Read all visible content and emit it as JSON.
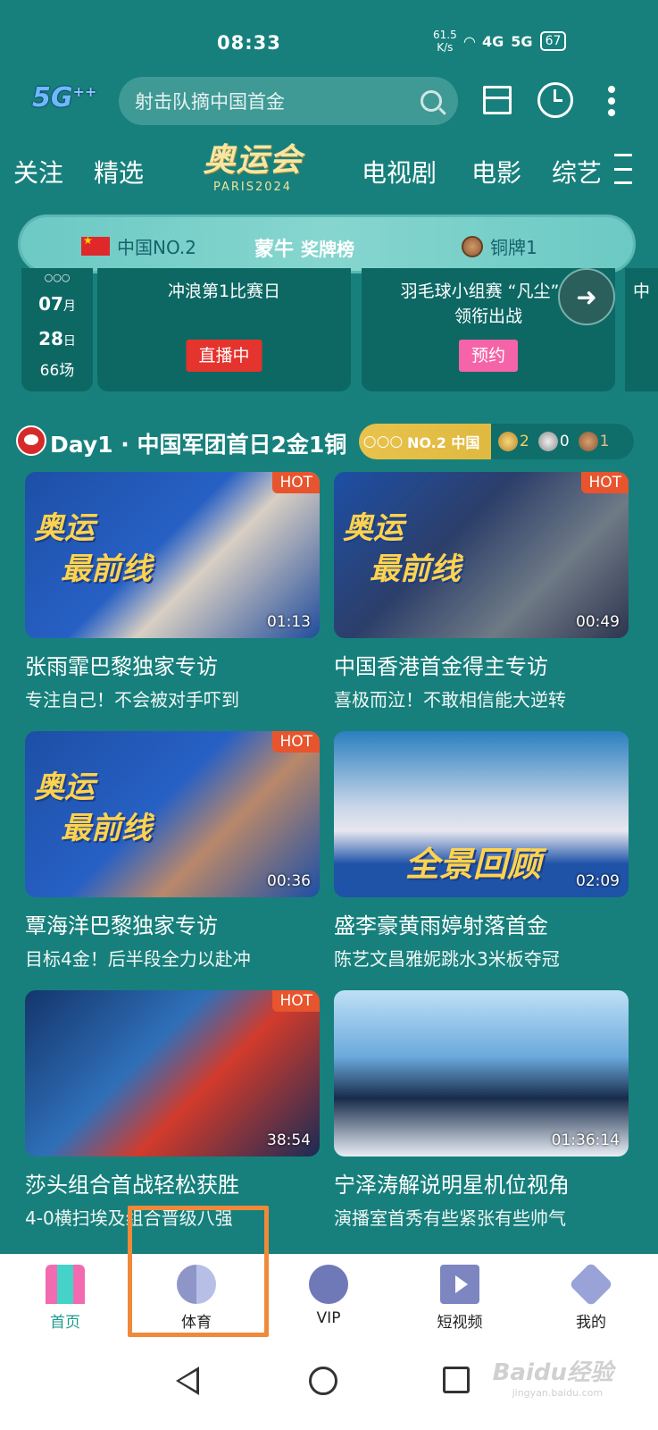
{
  "status": {
    "time": "08:33",
    "net_speed_value": "61.5",
    "net_speed_unit": "K/s",
    "sig1": "4G",
    "sig2": "5G",
    "battery": "67"
  },
  "header": {
    "logo": "5G",
    "logo_sup": "++",
    "search_placeholder": "射击队摘中国首金"
  },
  "tabs": {
    "follow": "关注",
    "featured": "精选",
    "olympic_title": "奥运会",
    "olympic_sub": "PARIS2024",
    "tv": "电视剧",
    "movie": "电影",
    "variety": "综艺"
  },
  "medal_banner": {
    "rank": "中国NO.2",
    "brand": "蒙牛",
    "board": "奖牌榜",
    "bronze": "铜牌1"
  },
  "schedule": {
    "month": "07",
    "month_unit": "月",
    "day": "28",
    "day_unit": "日",
    "count": "66场",
    "match1_title": "冲浪第1比赛日",
    "match1_btn": "直播中",
    "match2_title_line1": "羽毛球小组赛 “凡尘”组",
    "match2_title_line2": "领衔出战",
    "match2_btn": "预约",
    "match3_peek": "中"
  },
  "section": {
    "title": "Day1 · 中国军团首日2金1铜",
    "strip_rank": "NO.2 中国",
    "gold": "2",
    "silver": "0",
    "bronze": "1"
  },
  "videos": [
    {
      "title": "张雨霏巴黎独家专访",
      "subtitle": "专注自己！不会被对手吓到",
      "duration": "01:13",
      "hot": "HOT",
      "overlay1": "奥运",
      "overlay2": "最前线"
    },
    {
      "title": "中国香港首金得主专访",
      "subtitle": "喜极而泣！不敢相信能大逆转",
      "duration": "00:49",
      "hot": "HOT",
      "overlay1": "奥运",
      "overlay2": "最前线"
    },
    {
      "title": "覃海洋巴黎独家专访",
      "subtitle": "目标4金！后半段全力以赴冲",
      "duration": "00:36",
      "hot": "HOT",
      "overlay1": "奥运",
      "overlay2": "最前线"
    },
    {
      "title": "盛李豪黄雨婷射落首金",
      "subtitle": "陈艺文昌雅妮跳水3米板夺冠",
      "duration": "02:09",
      "overlay2": "全景回顾"
    },
    {
      "title": "莎头组合首战轻松获胜",
      "subtitle": "4-0横扫埃及组合晋级八强",
      "duration": "38:54",
      "hot": "HOT"
    },
    {
      "title": "宁泽涛解说明星机位视角",
      "subtitle": "演播室首秀有些紧张有些帅气",
      "duration": "01:36:14"
    }
  ],
  "bottom_nav": {
    "home": "首页",
    "sports": "体育",
    "vip": "VIP",
    "short_video": "短视频",
    "mine": "我的"
  },
  "watermark": {
    "main": "Baidu经验",
    "sub": "jingyan.baidu.com"
  },
  "colors": {
    "background": "#17807c",
    "highlight": "#f0893a",
    "live": "#e5332d",
    "reserve": "#f564a8"
  }
}
